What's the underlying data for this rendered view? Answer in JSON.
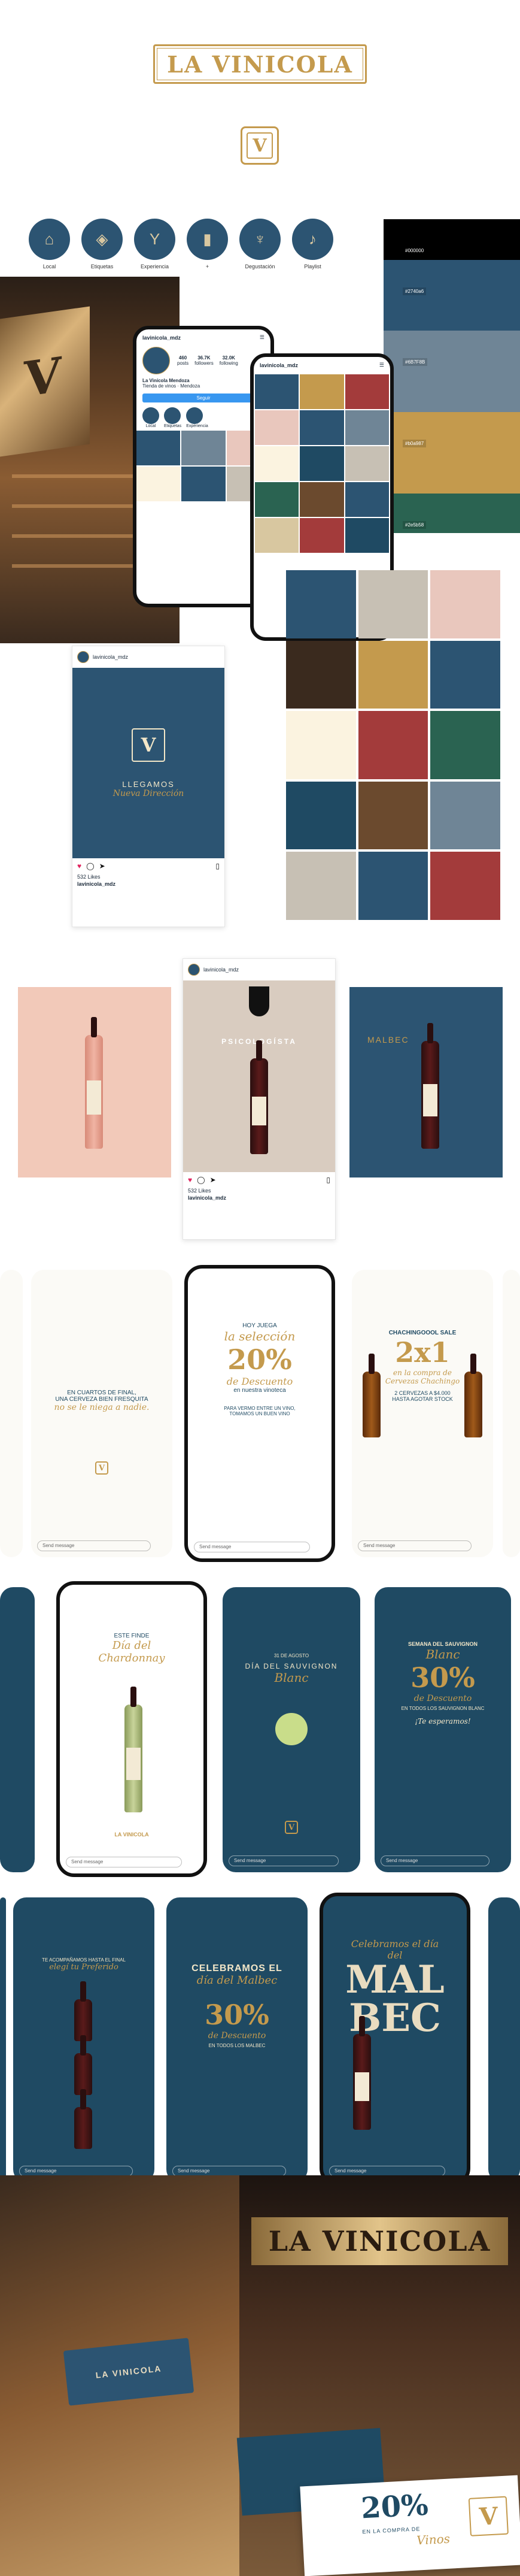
{
  "brand": {
    "logo_text": "LA VINICOLA",
    "mark_letter": "V"
  },
  "highlights": [
    {
      "label": "Local",
      "icon": "storefront-icon",
      "glyph": "⌂"
    },
    {
      "label": "Etiquetas",
      "icon": "label-icon",
      "glyph": "◈"
    },
    {
      "label": "Experiencia",
      "icon": "glass-icon",
      "glyph": "Y"
    },
    {
      "label": "+",
      "icon": "bottle-icon",
      "glyph": "▮"
    },
    {
      "label": "Degustación",
      "icon": "wine-glass-icon",
      "glyph": "♆"
    },
    {
      "label": "Playlist",
      "icon": "music-icon",
      "glyph": "♪"
    }
  ],
  "palette": [
    {
      "hex": "#000000",
      "label": "#000000"
    },
    {
      "hex": "#2c5472",
      "label": "#2740a6"
    },
    {
      "hex": "#6f8596",
      "label": "#6B7F8B"
    },
    {
      "hex": "#c49a4d",
      "label": "#b0a987"
    },
    {
      "hex": "#2a6351",
      "label": "#2e5b58"
    }
  ],
  "profile": {
    "handle": "lavinicola_mdz",
    "name": "La Vinícola Mendoza",
    "posts": "460",
    "posts_label": "posts",
    "followers": "36.7K",
    "followers_label": "followers",
    "following": "32.0K",
    "following_label": "following",
    "bio": "Tienda de vinos · Mendoza",
    "follow_label": "Seguir"
  },
  "profile_highlights": [
    "Local",
    "Etiquetas",
    "Experiencia"
  ],
  "post1": {
    "handle": "lavinicola_mdz",
    "overlay": "LLEGAMOS",
    "overlay_script": "Nueva Dirección",
    "likes": "532 Likes",
    "caption_user": "lavinicola_mdz"
  },
  "post2": {
    "handle": "lavinicola_mdz",
    "overlay": "PSICOLOGÍSTA",
    "likes": "532 Likes",
    "caption_user": "lavinicola_mdz"
  },
  "post3": {
    "overlay": "MALBEC"
  },
  "stories": {
    "message_placeholder": "Send message",
    "s1": {
      "line1": "EN CUARTOS DE FINAL,",
      "line2": "UNA CERVEZA BIEN FRESQUITA",
      "line3": "no se le niega a nadie."
    },
    "s2": {
      "top": "HOY JUEGA",
      "script": "la selección",
      "pct": "20%",
      "script2": "de Descuento",
      "line": "en nuestra vinoteca",
      "foot": "PARA VERMO ENTRE UN VINO, TOMAMOS UN BUEN VINO"
    },
    "s3": {
      "top": "CHACHINGOOOL SALE",
      "big": "2x1",
      "script": "en la compra de Cervezas Chachingo",
      "line": "2 CERVEZAS A $4.000",
      "foot": "HASTA AGOTAR STOCK"
    },
    "s4": {
      "top": "ESTE FINDE",
      "script": "Día del Chardonnay",
      "brand": "LA VINICOLA"
    },
    "s5": {
      "top": "31 DE AGOSTO",
      "line": "DÍA DEL SAUVIGNON",
      "script": "Blanc"
    },
    "s6": {
      "top": "SEMANA DEL SAUVIGNON",
      "script": "Blanc",
      "pct": "30%",
      "script2": "de Descuento",
      "line": "EN TODOS LOS SAUVIGNON BLANC",
      "extra": "¡Te esperamos!"
    },
    "s7": {
      "top": "TE ACOMPAÑAMOS HASTA EL FINAL",
      "script": "elegí tu Preferido"
    },
    "s8": {
      "line1": "CELEBRAMOS EL",
      "line2": "día del Malbec",
      "pct": "30%",
      "script": "de Descuento",
      "foot": "EN TODOS LOS MALBEC"
    },
    "s9": {
      "script": "Celebramos el día del",
      "big": "MAL BEC"
    }
  },
  "shop": {
    "sign": "LA VINICOLA",
    "card": "LA VINICOLA",
    "coupon_pct": "20%",
    "coupon_line": "EN LA COMPRA DE",
    "coupon_script": "Vinos"
  }
}
